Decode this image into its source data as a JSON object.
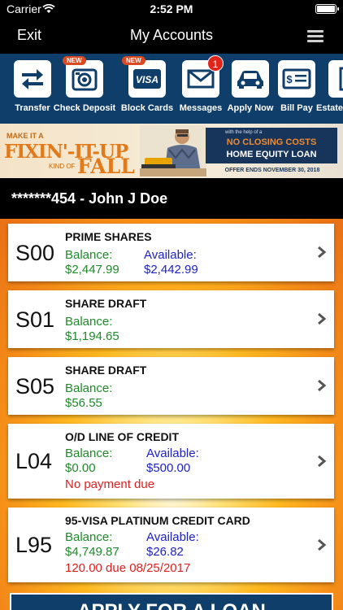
{
  "status_bar": {
    "carrier": "Carrier",
    "time": "2:52 PM"
  },
  "nav": {
    "left_button": "Exit",
    "title": "My Accounts"
  },
  "toolbar": {
    "items": [
      {
        "label": "Transfer",
        "icon": "transfer-icon"
      },
      {
        "label": "Check Deposit",
        "icon": "camera-deposit-icon",
        "badge": "NEW"
      },
      {
        "label": "Block Cards",
        "icon": "visa-card-icon",
        "badge": "NEW",
        "card_text": "VISA"
      },
      {
        "label": "Messages",
        "icon": "envelope-icon",
        "count": "1"
      },
      {
        "label": "Apply Now",
        "icon": "car-icon"
      },
      {
        "label": "Bill Pay",
        "icon": "bill-icon"
      },
      {
        "label": "Estate",
        "icon": "building-icon"
      }
    ]
  },
  "promo": {
    "line1": "MAKE IT A",
    "line2": "FIXIN'-IT-UP",
    "line3": "KIND OF",
    "line4": "FALL",
    "panel_line1": "with the help of a",
    "panel_line2": "NO CLOSING COSTS",
    "panel_line3": "HOME EQUITY LOAN",
    "footer": "OFFER ENDS NOVEMBER 30, 2018"
  },
  "member": {
    "label": "*******454 - John J Doe"
  },
  "accounts": [
    {
      "code": "S00",
      "name": "PRIME SHARES",
      "balance_label": "Balance:",
      "balance": "$2,447.99",
      "available_label": "Available:",
      "available": "$2,442.99"
    },
    {
      "code": "S01",
      "name": "SHARE DRAFT",
      "balance_label": "Balance:",
      "balance": "$1,194.65"
    },
    {
      "code": "S05",
      "name": "SHARE DRAFT",
      "balance_label": "Balance:",
      "balance": "$56.55"
    },
    {
      "code": "L04",
      "name": "O/D LINE OF CREDIT",
      "balance_label": "Balance:",
      "balance": "$0.00",
      "available_label": "Available:",
      "available": "$500.00",
      "note": "No payment due"
    },
    {
      "code": "L95",
      "name": "95-VISA PLATINUM CREDIT CARD",
      "balance_label": "Balance:",
      "balance": "$4,749.87",
      "available_label": "Available:",
      "available": "$26.82",
      "note": "120.00 due 08/25/2017"
    }
  ],
  "apply_button": {
    "label": "APPLY FOR A LOAN"
  },
  "colors": {
    "navy": "#0f3e6b",
    "balance_green": "#1f8a2a",
    "available_blue": "#1e22c8",
    "alert_red": "#e02020"
  }
}
